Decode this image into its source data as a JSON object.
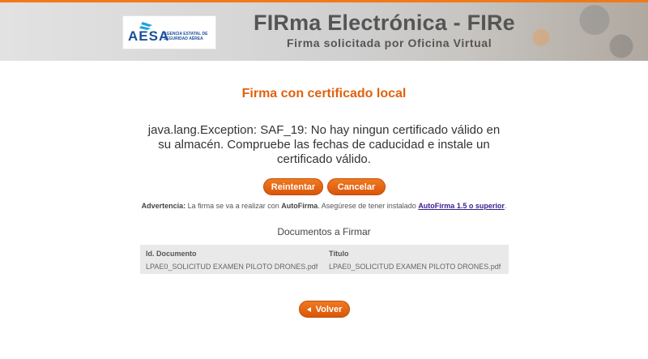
{
  "header": {
    "logo_text": "AESA",
    "logo_subtitle": "AGENCIA ESTATAL DE SEGURIDAD AÉREA",
    "title": "FIRma Electrónica - FIRe",
    "subtitle": "Firma solicitada por Oficina Virtual"
  },
  "main": {
    "title": "Firma con certificado local",
    "error_message": "java.lang.Exception: SAF_19: No hay ningun certificado válido en su almacén. Compruebe las fechas de caducidad e instale un certificado válido.",
    "retry_label": "Reintentar",
    "cancel_label": "Cancelar",
    "warning_label": "Advertencia:",
    "warning_text_1": " La firma se va a realizar con ",
    "warning_app": "AutoFirma",
    "warning_text_2": ". Asegúrese de tener instalado ",
    "warning_link": "AutoFirma 1.5 o superior",
    "warning_text_3": "."
  },
  "documents": {
    "title": "Documentos a Firmar",
    "columns": [
      "Id. Documento",
      "Título"
    ],
    "rows": [
      [
        "LPAE0_SOLICITUD EXAMEN PILOTO DRONES.pdf",
        "LPAE0_SOLICITUD EXAMEN PILOTO DRONES.pdf"
      ]
    ]
  },
  "footer": {
    "back_label": "Volver"
  },
  "colors": {
    "accent": "#e0620f",
    "button": "#e8680f",
    "top_stripe": "#f07a1a",
    "logo_blue": "#1a4f9c",
    "link": "#3a1f8f"
  }
}
